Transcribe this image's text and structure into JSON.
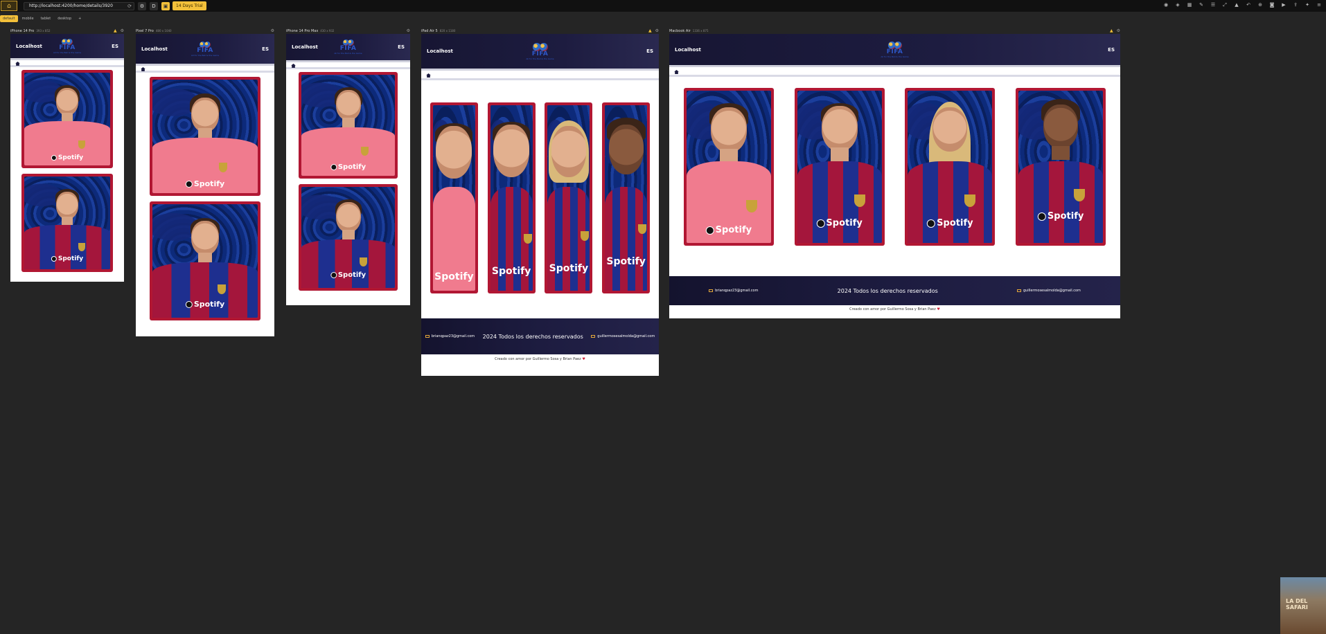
{
  "toolbar": {
    "url": "http://localhost:4200/home/details/3920",
    "trial_label": "14 Days Trial",
    "d_label": "D"
  },
  "tabs": [
    "default",
    "mobile",
    "tablet",
    "desktop",
    "+"
  ],
  "devices": [
    {
      "name": "iPhone 14 Pro",
      "size": "393 x 852"
    },
    {
      "name": "Pixel 7 Pro",
      "size": "480 x 1040"
    },
    {
      "name": "iPhone 14 Pro Max",
      "size": "430 x 932"
    },
    {
      "name": "iPad Air 5",
      "size": "820 x 1180"
    },
    {
      "name": "Macbook Air",
      "size": "1336 x 875"
    }
  ],
  "site": {
    "brand": "Localhost",
    "lang": "ES",
    "logo_text": "FIFA",
    "logo_sub": "All for the Ball & the Game",
    "sponsor": "Spotify",
    "footer_left": "brianqpaz23@gmail.com",
    "footer_rights": "2024 Todos los derechos reservados",
    "footer_right": "guillermosesalmolda@gmail.com",
    "made_by": "Creado con amor por Guillermo Sosa y Brian Paez"
  },
  "thumbnail_text": "LA DEL SAFARI"
}
